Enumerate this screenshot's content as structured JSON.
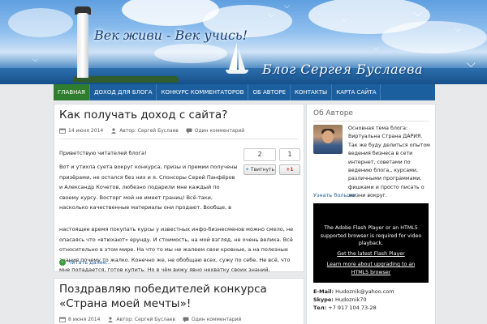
{
  "header": {
    "slogan": "Век живи - Век учись!",
    "blog_title": "Блог Сергея Буслаева"
  },
  "nav": {
    "items": [
      {
        "label": "ГЛАВНАЯ"
      },
      {
        "label": "ДОХОД ДЛЯ БЛОГА"
      },
      {
        "label": "КОНКУРС КОММЕНТАТОРОВ"
      },
      {
        "label": "ОБ АВТОРЕ"
      },
      {
        "label": "КОНТАКТЫ"
      },
      {
        "label": "КАРТА САЙТА"
      }
    ]
  },
  "post1": {
    "title": "Как получать доход с сайта?",
    "date": "14 июня 2014",
    "author": "Автор: Сергей Буслаев",
    "comments": "Один комментарий",
    "greeting": "Приветствую читателей блога!",
    "paragraph_top": "Вот и утихла суета вокруг конкурса, призы и премии получены призёрами, не остался без них и я. Спонсоры Серей Панфёров и Александр Кочетов, любезно подарили мне каждый по своему курсу. Восторг мой не имеет границ! Всё-таки, насколько качественные материалы они продают. Вообще, в",
    "paragraph_bottom": "настоящее время покупать курсы у известных инфо-бизнесменов можно смело, не опасаясь что «втюхают» ерунду. И стоимость, на мой взгляд, не очень велика. Всё относительно в этом мире. На что то мы не жалеем свои кровные, а на полезные знания почему то жалко. Конечно же, не обобщаю всех, сужу по себе. Не всё, что мне попадается, готов купить. Но в чём вижу явно нехватку своих знаний, обязательно приобретаю.",
    "readmore": "Читать далее...",
    "social": {
      "twitter_count": "2",
      "gplus_count": "1",
      "twitter_btn": "Твитнуть",
      "gplus_btn": "+1"
    }
  },
  "post2": {
    "title": "Поздравляю победителей конкурса «Страна моей мечты»!",
    "date": "8 июня 2014",
    "author": "Автор: Сергей Буслаев",
    "comments": "Один комментарий"
  },
  "sidebar": {
    "title": "Об Авторе",
    "about": "Основная тема блога: Виртуальна Страна ДАРИЯ. Так же буду делиться опытом ведения бизнеса в сети интернет, советами по ведению блога,, курсами, различными программами, фишками и просто писать о жизни вокруг.",
    "more": "Узнать больше",
    "flash_msg": "The Adobe Flash Player or an HTML5 supported browser is required for video playback.",
    "flash_link1": "Get the latest Flash Player",
    "flash_link2": "Learn more about upgrading to an HTML5 browser",
    "contacts": {
      "email_label": "E-Mail:",
      "email": "Hudoznik@yahoo.com",
      "skype_label": "Skype:",
      "skype": "Hudoznik70",
      "tel_label": "Тел:",
      "tel": "+7 917 104 73-28"
    }
  }
}
